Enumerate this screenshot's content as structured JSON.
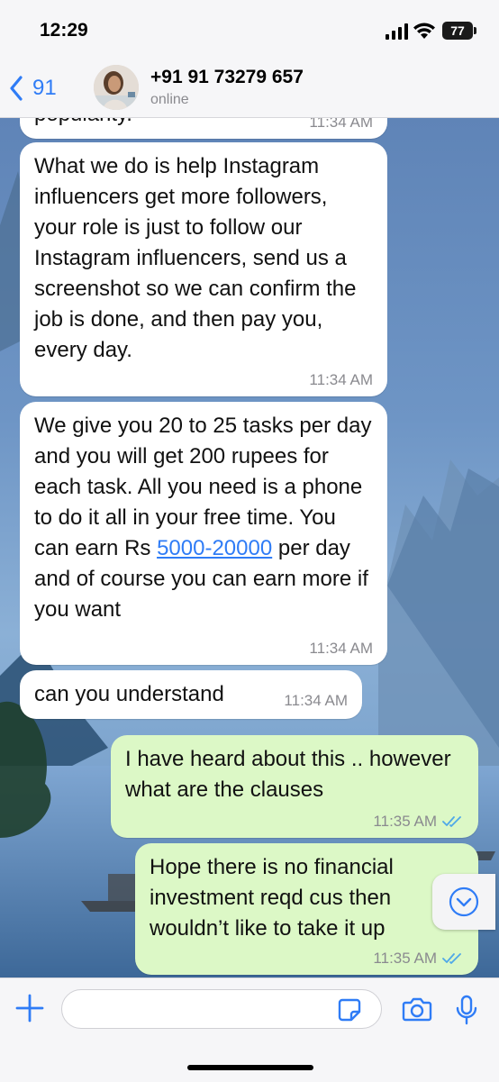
{
  "status_bar": {
    "time": "12:29",
    "battery": "77"
  },
  "header": {
    "back_count": "91",
    "contact_name": "+91 91 73279 657",
    "contact_status": "online"
  },
  "messages": [
    {
      "direction": "in",
      "text": "popularity.",
      "time": "11:34 AM"
    },
    {
      "direction": "in",
      "text": "What we do is help Instagram influencers get more followers, your role is just to follow our Instagram influencers, send us a screenshot so we can confirm the job is done, and then pay you, every day.",
      "time": "11:34 AM"
    },
    {
      "direction": "in",
      "text_before": "We give you 20 to 25 tasks per day and you will get 200 rupees for each task. All you need is a phone to do it all in your free time. You can earn Rs ",
      "link": "5000-20000",
      "text_after": " per day and of course you can earn more if you want",
      "time": "11:34 AM"
    },
    {
      "direction": "in",
      "text": "can you understand",
      "time": "11:34 AM"
    },
    {
      "direction": "out",
      "text": "I have heard about this .. however what are the clauses",
      "time": "11:35 AM",
      "status": "read"
    },
    {
      "direction": "out",
      "text": "Hope there is no financial investment reqd cus then wouldn’t like to take it up",
      "time": "11:35 AM",
      "status": "read"
    }
  ],
  "input": {
    "placeholder": ""
  },
  "colors": {
    "accent": "#2f7cf6",
    "incoming_bubble": "#ffffff",
    "outgoing_bubble": "#dcf8c6",
    "read_ticks": "#4fa8e8"
  },
  "icons": [
    "chevron-left-icon",
    "signal-icon",
    "wifi-icon",
    "battery-icon",
    "chevron-down-icon",
    "plus-icon",
    "sticker-icon",
    "camera-icon",
    "mic-icon",
    "double-check-icon"
  ]
}
